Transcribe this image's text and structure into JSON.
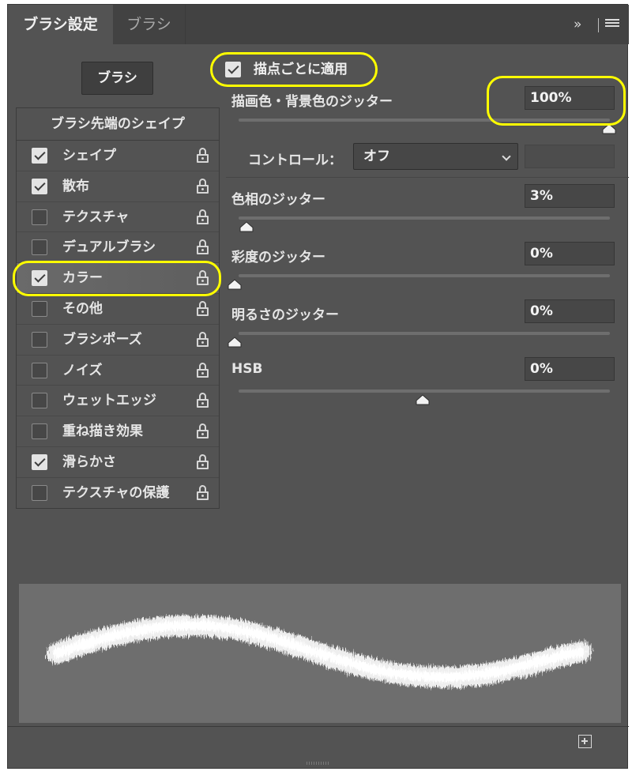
{
  "tabs": [
    {
      "label": "ブラシ設定",
      "active": true
    },
    {
      "label": "ブラシ",
      "active": false
    }
  ],
  "icons": {
    "collapse": "double-chevron-right-icon",
    "menu": "hamburger-menu-icon",
    "lock": "lock-open-icon",
    "new": "new-preset-icon"
  },
  "toolbar": {
    "collapse_glyph": "»"
  },
  "brush_button": "ブラシ",
  "settings_list": {
    "header": "ブラシ先端のシェイプ",
    "items": [
      {
        "label": "シェイプ",
        "checked": true,
        "selected": false
      },
      {
        "label": "散布",
        "checked": true,
        "selected": false
      },
      {
        "label": "テクスチャ",
        "checked": false,
        "selected": false
      },
      {
        "label": "デュアルブラシ",
        "checked": false,
        "selected": false
      },
      {
        "label": "カラー",
        "checked": true,
        "selected": true
      },
      {
        "label": "その他",
        "checked": false,
        "selected": false
      },
      {
        "label": "ブラシポーズ",
        "checked": false,
        "selected": false
      },
      {
        "label": "ノイズ",
        "checked": false,
        "selected": false
      },
      {
        "label": "ウェットエッジ",
        "checked": false,
        "selected": false
      },
      {
        "label": "重ね描き効果",
        "checked": false,
        "selected": false
      },
      {
        "label": "滑らかさ",
        "checked": true,
        "selected": false
      },
      {
        "label": "テクスチャの保護",
        "checked": false,
        "selected": false
      }
    ]
  },
  "color_dynamics": {
    "apply_per_tip": {
      "label": "描点ごとに適用",
      "checked": true
    },
    "fg_bg_jitter": {
      "label": "描画色・背景色のジッター",
      "value": "100%",
      "level": 1.0
    },
    "control": {
      "label": "コントロール：",
      "selected": "オフ",
      "extra_value": ""
    },
    "hue_jitter": {
      "label": "色相のジッター",
      "value": "3%",
      "level": 0.03
    },
    "saturation_jitter": {
      "label": "彩度のジッター",
      "value": "0%",
      "level": 0.0
    },
    "brightness_jitter": {
      "label": "明るさのジッター",
      "value": "0%",
      "level": 0.0
    },
    "purity": {
      "label": "HSB",
      "value": "0%",
      "level": 0.5
    }
  },
  "colors": {
    "panel_bg": "#535353",
    "highlight": "#ffff00",
    "preview_bg": "#6e6e6e"
  }
}
